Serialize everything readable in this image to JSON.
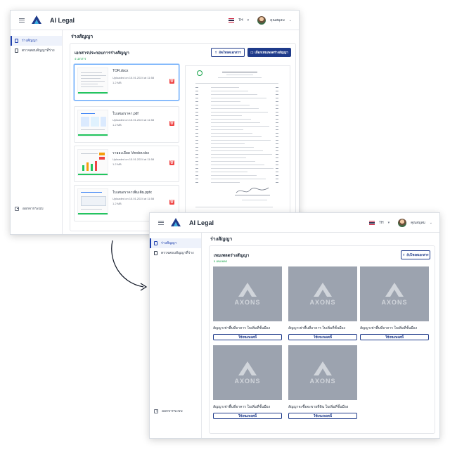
{
  "app": {
    "name": "AI Legal",
    "logo_text": "AXONS",
    "language": "TH",
    "user_name": "คุณสมุลม",
    "accent_color": "#1e3a8a"
  },
  "sidebar": {
    "items": [
      {
        "label": "ร่างสัญญา",
        "icon": "document-icon",
        "active": true
      },
      {
        "label": "ตรวจสอบสัญญาที่ร่าง",
        "icon": "calendar-icon",
        "active": false
      }
    ],
    "logout_label": "ออกจากระบบ"
  },
  "window1": {
    "page_title": "ร่างสัญญา",
    "card_title": "เอกสารประกอบการร่างสัญญา",
    "count_text": "4 เอกสาร",
    "buttons": {
      "upload": "อัพโหลดเอกสาร",
      "select_template": "เลือกเทมเพลตร่างสัญญา"
    },
    "files": [
      {
        "name": "TOR.docx",
        "uploaded": "Uploaded on 15.01.2024 at 11:58",
        "size": "1.2 MB"
      },
      {
        "name": "ใบเสนอราคา.pdf",
        "uploaded": "Uploaded on 15.01.2024 at 11:58",
        "size": "1.2 MB"
      },
      {
        "name": "รายละเอียด Vendor.xlsx",
        "uploaded": "Uploaded on 15.01.2024 at 11:58",
        "size": "1.2 MB"
      },
      {
        "name": "ใบเสนอราคาเพิ่มเติม.pptx",
        "uploaded": "Uploaded on 15.01.2024 at 11:58",
        "size": "1.2 MB"
      }
    ]
  },
  "window2": {
    "page_title": "ร่างสัญญา",
    "card_title": "เทมเพลตร่างสัญญา",
    "count_text": "5 เทมเพลต",
    "upload_button": "อัปโหลดเอกสาร",
    "templates": [
      {
        "name": "สัญญาเช่าพื้นที่อาคาร ใบเพิ่มที่ชั้นมือง",
        "button": "ใช้เทมเพลตนี้"
      },
      {
        "name": "สัญญาเช่าพื้นที่อาคาร ใบเพิ่มที่ชั้นมือง",
        "button": "ใช้เทมเพลตนี้"
      },
      {
        "name": "สัญญาเช่าพื้นที่อาคาร ใบเพิ่มที่ชั้นมือง",
        "button": "ใช้เทมเพลตนี้"
      },
      {
        "name": "สัญญาเช่าพื้นที่อาคาร ใบเพิ่มที่ชั้นมือง",
        "button": "ใช้เทมเพลตนี้"
      },
      {
        "name": "สัญญาจะซื้อจะขายที่ดิน ใบเพิ่มที่ชั้นมือง",
        "button": "ใช้เทมเพลตนี้"
      }
    ]
  }
}
